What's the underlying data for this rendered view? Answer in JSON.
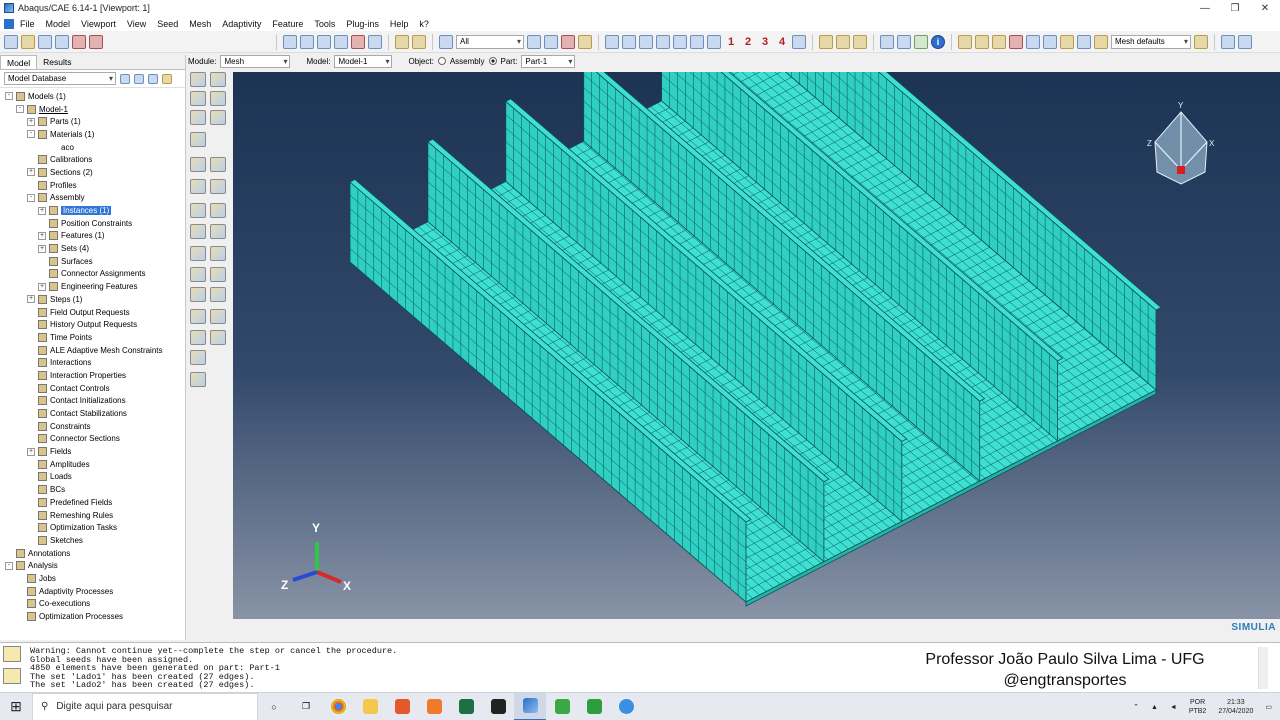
{
  "window": {
    "title": "Abaqus/CAE 6.14-1 [Viewport: 1]"
  },
  "menu": [
    "File",
    "Model",
    "Viewport",
    "View",
    "Seed",
    "Mesh",
    "Adaptivity",
    "Feature",
    "Tools",
    "Plug-ins",
    "Help",
    "k?"
  ],
  "toolbar": {
    "selection_filter": "All",
    "nums": [
      "1",
      "2",
      "3",
      "4"
    ],
    "mesh_defaults": "Mesh defaults"
  },
  "context": {
    "module_label": "Module:",
    "module_value": "Mesh",
    "model_label": "Model:",
    "model_value": "Model-1",
    "object_label": "Object:",
    "assembly_label": "Assembly",
    "part_label": "Part:",
    "part_value": "Part-1"
  },
  "tabs": [
    "Model",
    "Results"
  ],
  "tree_selector": "Model Database",
  "tree": [
    {
      "depth": 0,
      "exp": "-",
      "label": "Models (1)"
    },
    {
      "depth": 1,
      "exp": "-",
      "label": "Model-1",
      "underline": true
    },
    {
      "depth": 2,
      "exp": "+",
      "label": "Parts (1)"
    },
    {
      "depth": 2,
      "exp": "-",
      "label": "Materials (1)"
    },
    {
      "depth": 3,
      "exp": "",
      "label": "aco",
      "noicon": true
    },
    {
      "depth": 2,
      "exp": "",
      "label": "Calibrations"
    },
    {
      "depth": 2,
      "exp": "+",
      "label": "Sections (2)"
    },
    {
      "depth": 2,
      "exp": "",
      "label": "Profiles"
    },
    {
      "depth": 2,
      "exp": "-",
      "label": "Assembly"
    },
    {
      "depth": 3,
      "exp": "+",
      "label": "Instances (1)",
      "selected": true
    },
    {
      "depth": 3,
      "exp": "",
      "label": "Position Constraints"
    },
    {
      "depth": 3,
      "exp": "+",
      "label": "Features (1)"
    },
    {
      "depth": 3,
      "exp": "+",
      "label": "Sets (4)"
    },
    {
      "depth": 3,
      "exp": "",
      "label": "Surfaces"
    },
    {
      "depth": 3,
      "exp": "",
      "label": "Connector Assignments"
    },
    {
      "depth": 3,
      "exp": "+",
      "label": "Engineering Features"
    },
    {
      "depth": 2,
      "exp": "+",
      "label": "Steps (1)"
    },
    {
      "depth": 2,
      "exp": "",
      "label": "Field Output Requests"
    },
    {
      "depth": 2,
      "exp": "",
      "label": "History Output Requests"
    },
    {
      "depth": 2,
      "exp": "",
      "label": "Time Points"
    },
    {
      "depth": 2,
      "exp": "",
      "label": "ALE Adaptive Mesh Constraints"
    },
    {
      "depth": 2,
      "exp": "",
      "label": "Interactions"
    },
    {
      "depth": 2,
      "exp": "",
      "label": "Interaction Properties"
    },
    {
      "depth": 2,
      "exp": "",
      "label": "Contact Controls"
    },
    {
      "depth": 2,
      "exp": "",
      "label": "Contact Initializations"
    },
    {
      "depth": 2,
      "exp": "",
      "label": "Contact Stabilizations"
    },
    {
      "depth": 2,
      "exp": "",
      "label": "Constraints"
    },
    {
      "depth": 2,
      "exp": "",
      "label": "Connector Sections"
    },
    {
      "depth": 2,
      "exp": "+",
      "label": "Fields"
    },
    {
      "depth": 2,
      "exp": "",
      "label": "Amplitudes"
    },
    {
      "depth": 2,
      "exp": "",
      "label": "Loads"
    },
    {
      "depth": 2,
      "exp": "",
      "label": "BCs"
    },
    {
      "depth": 2,
      "exp": "",
      "label": "Predefined Fields"
    },
    {
      "depth": 2,
      "exp": "",
      "label": "Remeshing Rules"
    },
    {
      "depth": 2,
      "exp": "",
      "label": "Optimization Tasks"
    },
    {
      "depth": 2,
      "exp": "",
      "label": "Sketches"
    },
    {
      "depth": 0,
      "exp": "",
      "label": "Annotations"
    },
    {
      "depth": 0,
      "exp": "-",
      "label": "Analysis"
    },
    {
      "depth": 1,
      "exp": "",
      "label": "Jobs"
    },
    {
      "depth": 1,
      "exp": "",
      "label": "Adaptivity Processes"
    },
    {
      "depth": 1,
      "exp": "",
      "label": "Co-executions"
    },
    {
      "depth": 1,
      "exp": "",
      "label": "Optimization Processes"
    }
  ],
  "viewport": {
    "triad": {
      "x": "X",
      "y": "Y",
      "z": "Z"
    },
    "compass": {
      "x": "X",
      "y": "Y",
      "z": "Z"
    },
    "brand": "SIMULIA",
    "mesh_color": "#3de0d2",
    "mesh_line_color": "#0b4f52"
  },
  "messages": [
    "Warning: Cannot continue yet--complete the step or cancel the procedure.",
    "Global seeds have been assigned.",
    "4850 elements have been generated on part: Part-1",
    "The set 'Lado1' has been created (27 edges).",
    "The set 'Lado2' has been created (27 edges)."
  ],
  "credit": {
    "line1": "Professor João Paulo Silva Lima - UFG",
    "line2": "@engtransportes"
  },
  "taskbar": {
    "search_placeholder": "Digite aqui para pesquisar",
    "lang": "POR",
    "layout": "PTB2",
    "time": "21:33",
    "date": "27/04/2020"
  }
}
